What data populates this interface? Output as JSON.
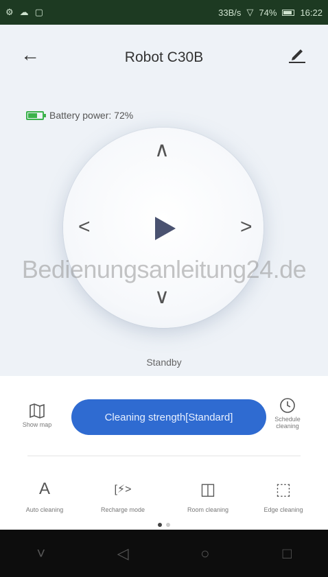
{
  "status_bar": {
    "left_icons": [
      "⚙",
      "☁",
      "▢"
    ],
    "network_speed": "33B/s",
    "battery_percent": "74%",
    "time": "16:22"
  },
  "header": {
    "title": "Robot C30B",
    "back_icon": "←"
  },
  "battery": {
    "label": "Battery power: 72%",
    "level_percent": 72,
    "color": "#3bb24b"
  },
  "dpad": {
    "up": "∧",
    "down": "∨",
    "left": "<",
    "right": ">"
  },
  "watermark": "Bedienungsanleitung24.de",
  "status_text": "Standby",
  "controls": {
    "map_label": "Show map",
    "strength_label": "Cleaning strength[Standard]",
    "schedule_label": "Schedule cleaning"
  },
  "modes": [
    {
      "icon": "A",
      "label": "Auto cleaning"
    },
    {
      "icon": "[⚡>",
      "label": "Recharge mode"
    },
    {
      "icon": "◫",
      "label": "Room cleaning"
    },
    {
      "icon": "⬚",
      "label": "Edge cleaning"
    }
  ],
  "pagination": {
    "current": 1,
    "total": 2
  },
  "nav_bar": {
    "menu": "˅",
    "back": "◁",
    "home": "○",
    "recents": "□"
  },
  "colors": {
    "accent": "#2f6bd1",
    "status_bar": "#1d3a22",
    "background": "#eef2f7",
    "battery": "#3bb24b"
  }
}
